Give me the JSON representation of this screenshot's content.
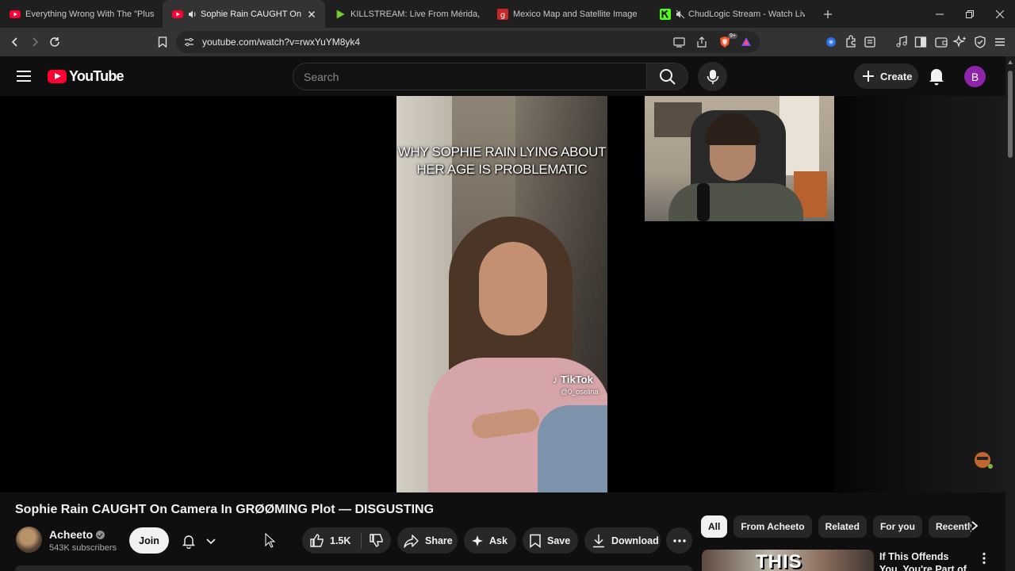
{
  "browser": {
    "tabs": [
      {
        "title": "Everything Wrong With The \"Plus Size\"",
        "favicon": "youtube-icon",
        "active": false
      },
      {
        "title": "Sophie Rain CAUGHT On Camera",
        "favicon": "youtube-icon",
        "active": true,
        "audio": true
      },
      {
        "title": "KILLSTREAM: Live From Mérida, Mexico",
        "favicon": "rumble-icon",
        "active": false
      },
      {
        "title": "Mexico Map and Satellite Image",
        "favicon": "geology-icon",
        "active": false
      },
      {
        "title": "ChudLogic Stream - Watch Live on Kick",
        "favicon": "kick-icon",
        "active": false,
        "audio": true
      }
    ],
    "url": "youtube.com/watch?v=rwxYuYM8yk4",
    "brave_badge": "9+"
  },
  "youtube": {
    "logo_text": "YouTube",
    "search_placeholder": "Search",
    "create_label": "Create",
    "avatar_letter": "B"
  },
  "video": {
    "title": "Sophie Rain CAUGHT On Camera In GRØØMING Plot — DISGUSTING",
    "tiktok_caption": "WHY SOPHIE RAIN LYING ABOUT HER AGE IS PROBLEMATIC",
    "tiktok_logo": "TikTok",
    "tiktok_handle": "@0_oselina"
  },
  "channel": {
    "name": "Acheeto",
    "subscribers": "543K subscribers",
    "join_label": "Join"
  },
  "actions": {
    "likes": "1.5K",
    "share": "Share",
    "ask": "Ask",
    "save": "Save",
    "download": "Download"
  },
  "chips": [
    "All",
    "From Acheeto",
    "Related",
    "For you",
    "Recently uploaded"
  ],
  "recommendation": {
    "thumb_text": "THIS",
    "title": "If This Offends You, You're Part of the"
  },
  "colors": {
    "accent_red": "#ff0033",
    "avatar_purple": "#8e24aa",
    "background": "#0f0f0f"
  }
}
